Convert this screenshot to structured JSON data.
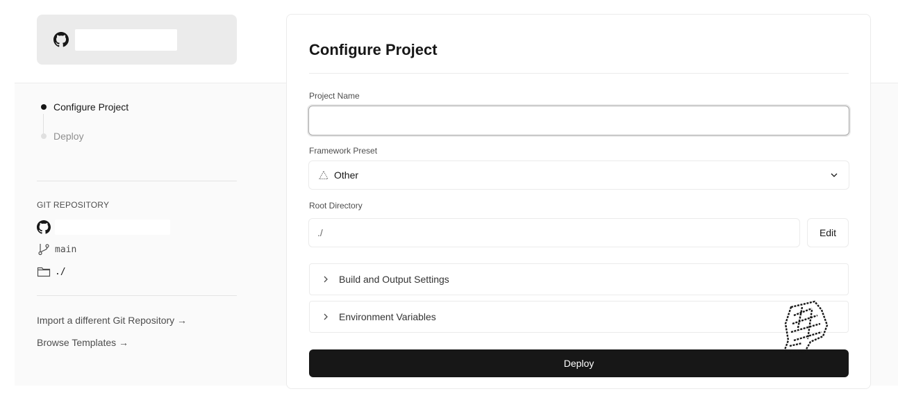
{
  "sidebar": {
    "repo_card": {
      "icon": "github-icon",
      "name": ""
    },
    "steps": [
      {
        "label": "Configure Project",
        "state": "active"
      },
      {
        "label": "Deploy",
        "state": "inactive"
      }
    ],
    "git": {
      "heading": "GIT REPOSITORY",
      "repo_name": "",
      "branch": "main",
      "directory": "./"
    },
    "links": {
      "import": "Import a different Git Repository →",
      "templates": "Browse Templates →"
    }
  },
  "form": {
    "title": "Configure Project",
    "project_name": {
      "label": "Project Name",
      "value": "",
      "placeholder": ""
    },
    "framework": {
      "label": "Framework Preset",
      "selected": "Other",
      "icon": "framework-other-icon"
    },
    "root": {
      "label": "Root Directory",
      "value": "./",
      "edit_label": "Edit"
    },
    "sections": [
      {
        "label": "Build and Output Settings"
      },
      {
        "label": "Environment Variables"
      }
    ],
    "deploy_label": "Deploy"
  },
  "colors": {
    "primary": "#171717",
    "border": "#ebebeb",
    "muted": "#8f8f8f",
    "card_grey": "#ebebeb"
  }
}
